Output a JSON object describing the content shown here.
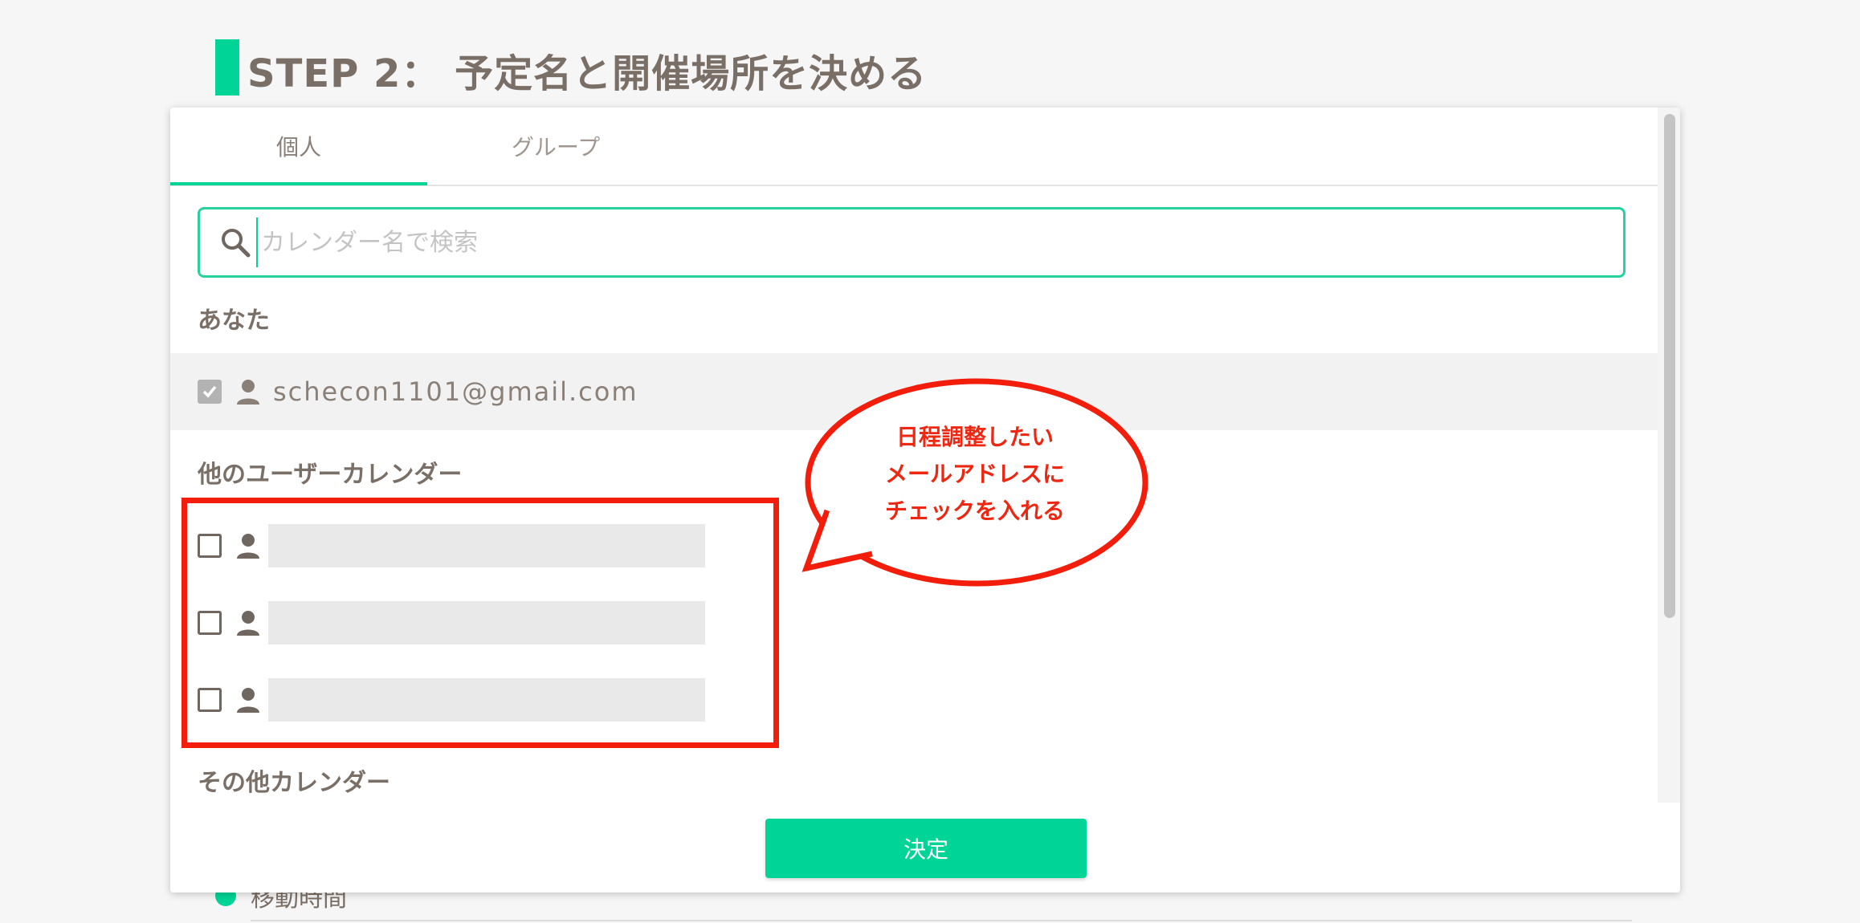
{
  "page": {
    "step_title": "STEP 2： 予定名と開催場所を決める",
    "background_item_label": "移動時間"
  },
  "modal": {
    "tabs": [
      {
        "label": "個人",
        "active": true
      },
      {
        "label": "グループ",
        "active": false
      }
    ],
    "search": {
      "placeholder": "カレンダー名で検索",
      "value": ""
    },
    "section_you": "あなた",
    "you": {
      "email": "schecon1101@gmail.com",
      "checked": true
    },
    "section_other_users": "他のユーザーカレンダー",
    "other_users": [
      {
        "checked": false
      },
      {
        "checked": false
      },
      {
        "checked": false
      }
    ],
    "section_other_calendars": "その他カレンダー",
    "confirm_label": "決定"
  },
  "annotation": {
    "callout_lines": [
      "日程調整したい",
      "メールアドレスに",
      "チェックを入れる"
    ],
    "color": "#f21d0a"
  },
  "colors": {
    "accent": "#00d496",
    "text": "#7a6f66"
  }
}
